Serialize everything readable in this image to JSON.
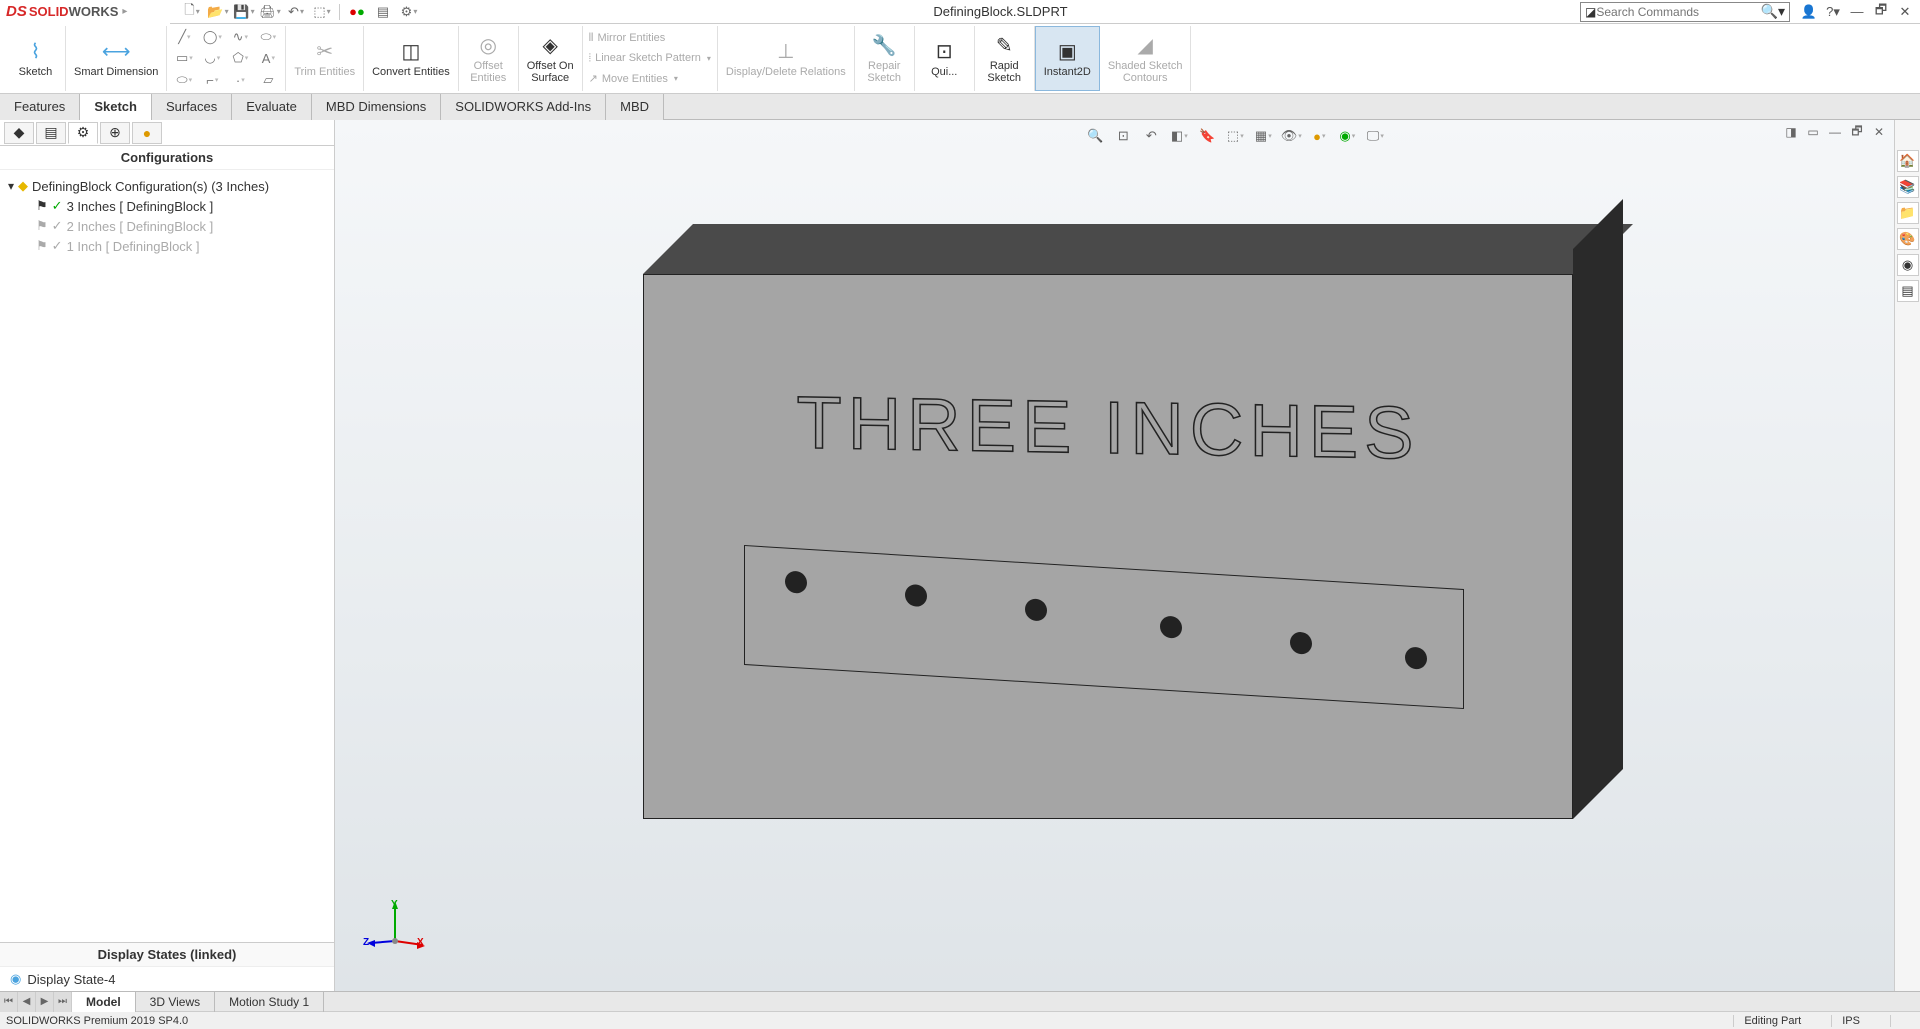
{
  "app": {
    "logo_ds": "DS",
    "logo_solid": "SOLID",
    "logo_works": "WORKS",
    "document_title": "DefiningBlock.SLDPRT",
    "search_placeholder": "Search Commands"
  },
  "ribbon": {
    "sketch": "Sketch",
    "smart_dimension": "Smart Dimension",
    "trim_entities": "Trim Entities",
    "convert_entities": "Convert Entities",
    "offset_entities": "Offset\nEntities",
    "offset_on_surface": "Offset On\nSurface",
    "mirror_entities": "Mirror Entities",
    "linear_pattern": "Linear Sketch Pattern",
    "move_entities": "Move Entities",
    "display_delete": "Display/Delete Relations",
    "repair_sketch": "Repair\nSketch",
    "quick_snaps": "Qui...",
    "rapid_sketch": "Rapid\nSketch",
    "instant2d": "Instant2D",
    "shaded_contours": "Shaded Sketch\nContours"
  },
  "tabs": {
    "features": "Features",
    "sketch": "Sketch",
    "surfaces": "Surfaces",
    "evaluate": "Evaluate",
    "mbd_dimensions": "MBD Dimensions",
    "solidworks_addins": "SOLIDWORKS Add-Ins",
    "mbd": "MBD"
  },
  "panel": {
    "header": "Configurations",
    "root": "DefiningBlock Configuration(s)  (3 Inches)",
    "config_1": "3 Inches [ DefiningBlock ]",
    "config_2": "2 Inches [ DefiningBlock ]",
    "config_3": "1 Inch [ DefiningBlock ]",
    "display_states_header": "Display States (linked)",
    "display_state_1": "Display State-4"
  },
  "model": {
    "engraved_text": "THREE INCHES"
  },
  "bottom_tabs": {
    "model": "Model",
    "views_3d": "3D Views",
    "motion_study": "Motion Study 1"
  },
  "status": {
    "product": "SOLIDWORKS Premium 2019 SP4.0",
    "mode": "Editing Part",
    "units": "IPS"
  }
}
